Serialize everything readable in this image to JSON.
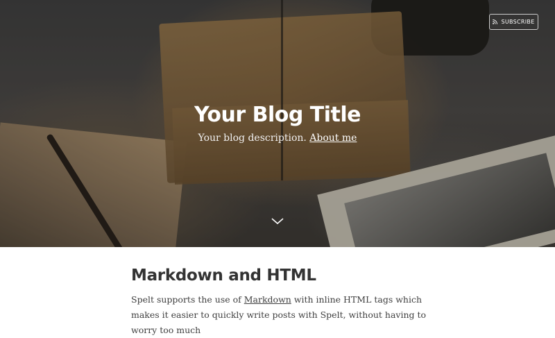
{
  "header": {
    "subscribe_label": "SUBSCRIBE",
    "subscribe_icon": "rss-icon",
    "title": "Your Blog Title",
    "description": "Your blog description.",
    "about_link": "About me",
    "scroll_icon": "chevron-down-icon"
  },
  "post": {
    "title": "Markdown and HTML",
    "body_before_link": "Spelt supports the use of ",
    "body_link": "Markdown",
    "body_after_link": " with inline HTML tags which makes it easier to quickly write posts with Spelt, without having to worry too much"
  },
  "colors": {
    "hero_overlay": "#2b2622",
    "title_text": "#ffffff",
    "body_text": "#3e3e3e"
  }
}
